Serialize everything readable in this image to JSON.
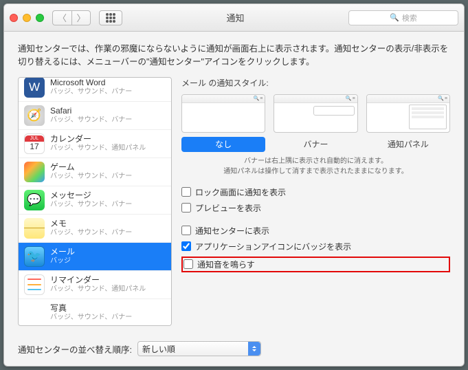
{
  "title": "通知",
  "search_placeholder": "検索",
  "description": "通知センターでは、作業の邪魔にならないように通知が画面右上に表示されます。通知センターの表示/非表示を切り替えるには、メニューバーの\"通知センター\"アイコンをクリックします。",
  "apps": [
    {
      "name": "Microsoft Word",
      "sub": "バッジ、サウンド、バナー",
      "icon": "word",
      "glyph": "W"
    },
    {
      "name": "Safari",
      "sub": "バッジ、サウンド、バナー",
      "icon": "safari",
      "glyph": "🧭"
    },
    {
      "name": "カレンダー",
      "sub": "バッジ、サウンド、通知パネル",
      "icon": "cal",
      "glyph": "",
      "cal_month": "JUL",
      "cal_day": "17"
    },
    {
      "name": "ゲーム",
      "sub": "バッジ、サウンド、バナー",
      "icon": "game",
      "glyph": ""
    },
    {
      "name": "メッセージ",
      "sub": "バッジ、サウンド、バナー",
      "icon": "msg",
      "glyph": "💬"
    },
    {
      "name": "メモ",
      "sub": "バッジ、サウンド、バナー",
      "icon": "memo",
      "glyph": ""
    },
    {
      "name": "メール",
      "sub": "バッジ",
      "icon": "mail",
      "glyph": "🐦",
      "selected": true
    },
    {
      "name": "リマインダー",
      "sub": "バッジ、サウンド、通知パネル",
      "icon": "rem",
      "glyph": ""
    },
    {
      "name": "写真",
      "sub": "バッジ、サウンド、バナー",
      "icon": "photo",
      "glyph": "✳︎"
    }
  ],
  "detail": {
    "style_title": "メール の通知スタイル:",
    "styles": {
      "none": "なし",
      "banner": "バナー",
      "panel": "通知パネル"
    },
    "hint1": "バナーは右上隅に表示され自動的に消えます。",
    "hint2": "通知パネルは操作して消すまで表示されたままになります。",
    "chk_lock": "ロック画面に通知を表示",
    "chk_preview": "プレビューを表示",
    "chk_center": "通知センターに表示",
    "chk_badge": "アプリケーションアイコンにバッジを表示",
    "chk_sound": "通知音を鳴らす"
  },
  "footer": {
    "label": "通知センターの並べ替え順序:",
    "value": "新しい順"
  }
}
